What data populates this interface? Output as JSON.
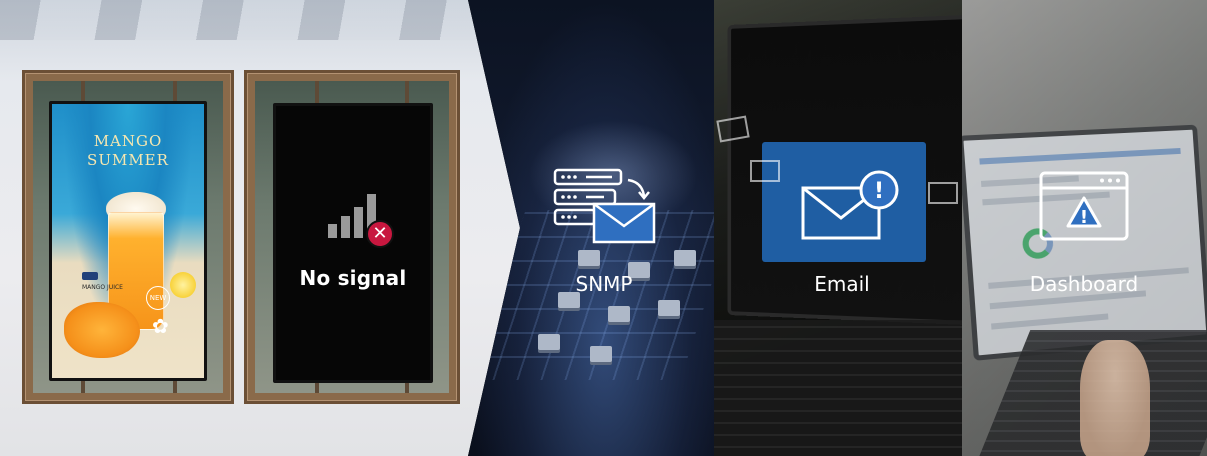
{
  "signage": {
    "ad_title_line1": "MANGO",
    "ad_title_line2": "SUMMER",
    "ad_badge": "NEW",
    "ad_subtitle": "MANGO JUICE",
    "no_signal_text": "No signal"
  },
  "features": [
    {
      "label": "SNMP",
      "icon": "server-mail-icon"
    },
    {
      "label": "Email",
      "icon": "envelope-alert-icon"
    },
    {
      "label": "Dashboard",
      "icon": "window-warning-icon"
    }
  ],
  "colors": {
    "alert_red": "#c8173f",
    "accent_blue": "#1f5ea3",
    "icon_blue": "#2f6fc0",
    "label_white": "#ffffff"
  }
}
